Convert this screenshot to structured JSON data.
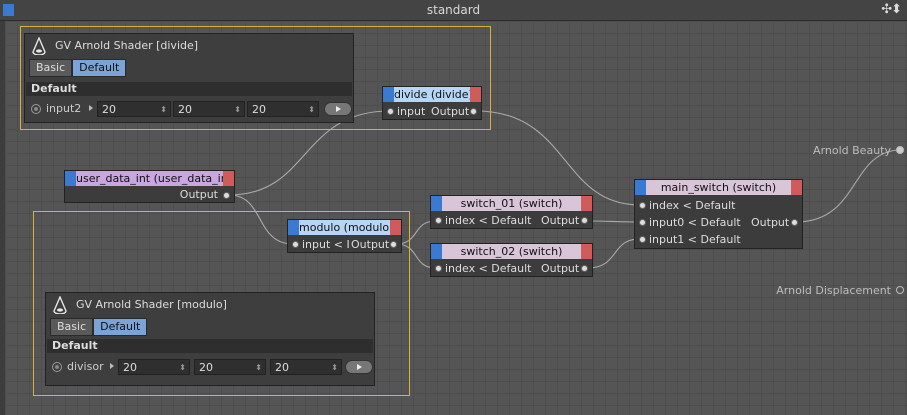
{
  "window": {
    "title": "standard",
    "controls": "✣⬍"
  },
  "panels": {
    "divide": {
      "title": "GV Arnold Shader [divide]",
      "tabs": [
        "Basic",
        "Default"
      ],
      "active_tab": "Default",
      "section": "Default",
      "param": {
        "label": "input2",
        "values": [
          "20",
          "20",
          "20"
        ]
      }
    },
    "modulo": {
      "title": "GV Arnold Shader [modulo]",
      "tabs": [
        "Basic",
        "Default"
      ],
      "active_tab": "Default",
      "section": "Default",
      "param": {
        "label": "divisor",
        "values": [
          "20",
          "20",
          "20"
        ]
      }
    }
  },
  "nodes": {
    "divide": {
      "title": "divide (divide)",
      "color": "#b7d6f5",
      "in": "input",
      "out": "Output"
    },
    "user_data_int": {
      "title": "user_data_int (user_data_int)",
      "color": "#c9a6df",
      "out": "Output"
    },
    "modulo": {
      "title": "modulo (modulo)",
      "color": "#b7d6f5",
      "in": "input < I",
      "out": "Output"
    },
    "switch_01": {
      "title": "switch_01 (switch)",
      "color": "#d9c5d9",
      "in": "index < Default",
      "out": "Output"
    },
    "switch_02": {
      "title": "switch_02 (switch)",
      "color": "#d9c5d9",
      "in": "index < Default",
      "out": "Output"
    },
    "main_switch": {
      "title": "main_switch (switch)",
      "color": "#d9c5d9",
      "inputs": [
        "index < Default",
        "input0 < Default",
        "input1 < Default"
      ],
      "out": "Output"
    }
  },
  "outputs": {
    "beauty": "Arnold Beauty",
    "displacement": "Arnold Displacement"
  }
}
